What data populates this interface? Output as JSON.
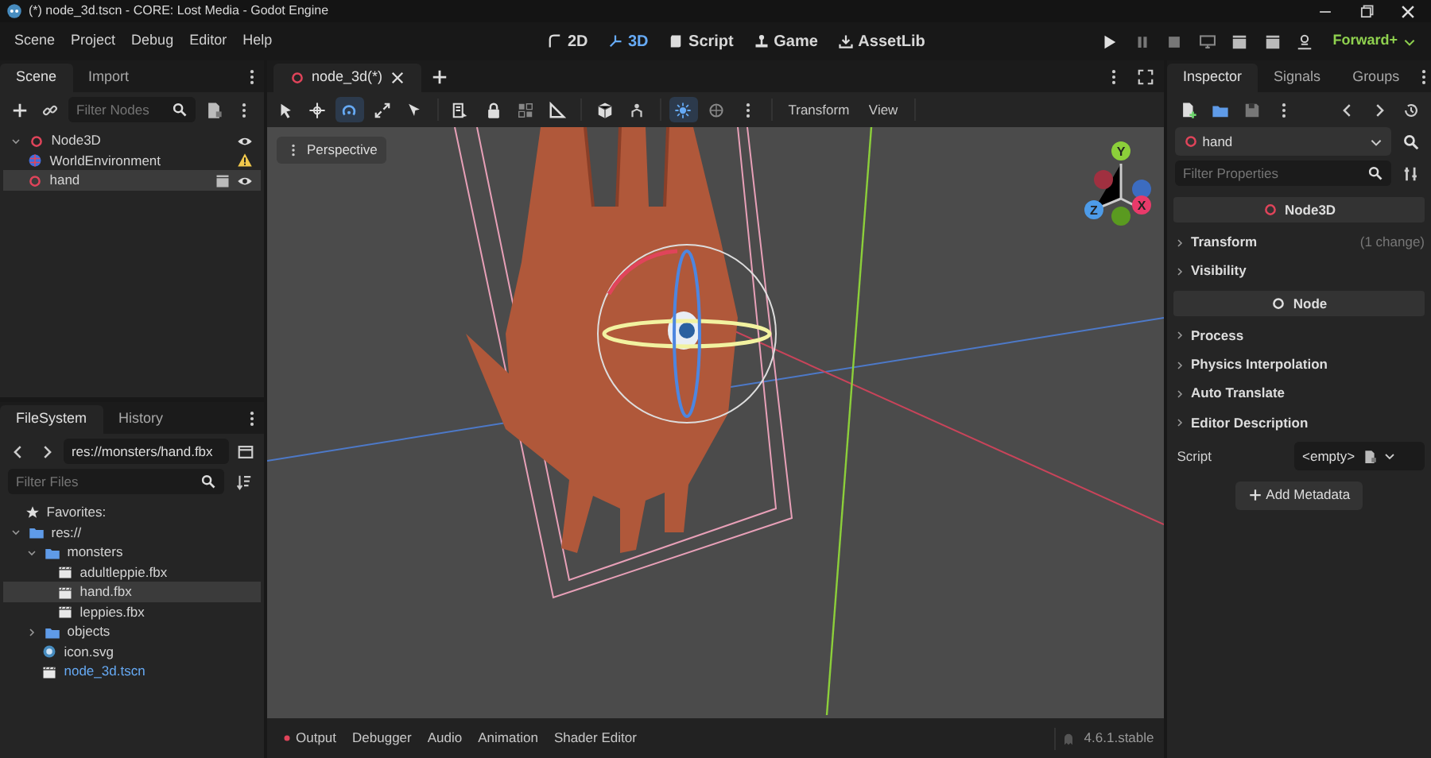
{
  "window": {
    "title": "(*) node_3d.tscn - CORE: Lost Media - Godot Engine"
  },
  "menu": [
    "Scene",
    "Project",
    "Debug",
    "Editor",
    "Help"
  ],
  "workspaces": [
    {
      "label": "2D",
      "selected": false
    },
    {
      "label": "3D",
      "selected": true
    },
    {
      "label": "Script",
      "selected": false
    },
    {
      "label": "Game",
      "selected": false
    },
    {
      "label": "AssetLib",
      "selected": false
    }
  ],
  "renderer": "Forward+",
  "scene_dock": {
    "tabs": [
      {
        "label": "Scene",
        "selected": true
      },
      {
        "label": "Import",
        "selected": false
      }
    ],
    "filter_placeholder": "Filter Nodes",
    "tree": [
      {
        "name": "Node3D",
        "kind": "node3d",
        "expanded": true,
        "selected": false,
        "warning": false,
        "instance": false,
        "children": [
          {
            "name": "WorldEnvironment",
            "kind": "environment",
            "selected": false,
            "warning": true,
            "instance": false
          },
          {
            "name": "hand",
            "kind": "node3d",
            "selected": true,
            "warning": false,
            "instance": true
          }
        ]
      }
    ]
  },
  "editor": {
    "tabs": [
      {
        "label": "node_3d(*)",
        "selected": true
      }
    ],
    "toolbar_menus": [
      "Transform",
      "View"
    ],
    "view_button": "Perspective",
    "gizmo_axes": [
      "Y",
      "Z",
      "X"
    ]
  },
  "bottom_panel": {
    "tabs": [
      {
        "label": "Output",
        "alert": true
      },
      {
        "label": "Debugger",
        "alert": false
      },
      {
        "label": "Audio",
        "alert": false
      },
      {
        "label": "Animation",
        "alert": false
      },
      {
        "label": "Shader Editor",
        "alert": false
      }
    ],
    "version": "4.6.1.stable"
  },
  "filesystem": {
    "tabs": [
      {
        "label": "FileSystem",
        "selected": true
      },
      {
        "label": "History",
        "selected": false
      }
    ],
    "path": "res://monsters/hand.fbx",
    "filter_placeholder": "Filter Files",
    "favorites": "Favorites:",
    "tree": [
      {
        "name": "res://",
        "kind": "folder",
        "expanded": true,
        "selected": false,
        "children": [
          {
            "name": "monsters",
            "kind": "folder",
            "expanded": true,
            "selected": false,
            "children": [
              {
                "name": "adultleppie.fbx",
                "kind": "scene",
                "selected": false
              },
              {
                "name": "hand.fbx",
                "kind": "scene",
                "selected": true
              },
              {
                "name": "leppies.fbx",
                "kind": "scene",
                "selected": false
              }
            ]
          },
          {
            "name": "objects",
            "kind": "folder",
            "expanded": false,
            "selected": false
          },
          {
            "name": "icon.svg",
            "kind": "image",
            "selected": false
          },
          {
            "name": "node_3d.tscn",
            "kind": "open_scene",
            "selected": false
          }
        ]
      }
    ]
  },
  "inspector": {
    "tabs": [
      {
        "label": "Inspector",
        "selected": true
      },
      {
        "label": "Signals",
        "selected": false
      },
      {
        "label": "Groups",
        "selected": false
      }
    ],
    "node": "hand",
    "filter_placeholder": "Filter Properties",
    "sections": [
      {
        "kind": "class",
        "label": "Node3D",
        "color": "#e0445a"
      },
      {
        "kind": "group",
        "label": "Transform",
        "note": "(1 change)"
      },
      {
        "kind": "group",
        "label": "Visibility"
      },
      {
        "kind": "class",
        "label": "Node",
        "color": "#e0e0e0"
      },
      {
        "kind": "group",
        "label": "Process"
      },
      {
        "kind": "group",
        "label": "Physics Interpolation"
      },
      {
        "kind": "group",
        "label": "Auto Translate"
      },
      {
        "kind": "group",
        "label": "Editor Description"
      },
      {
        "kind": "property",
        "label": "Script",
        "value": "<empty>"
      },
      {
        "kind": "button",
        "label": "Add Metadata"
      }
    ]
  }
}
